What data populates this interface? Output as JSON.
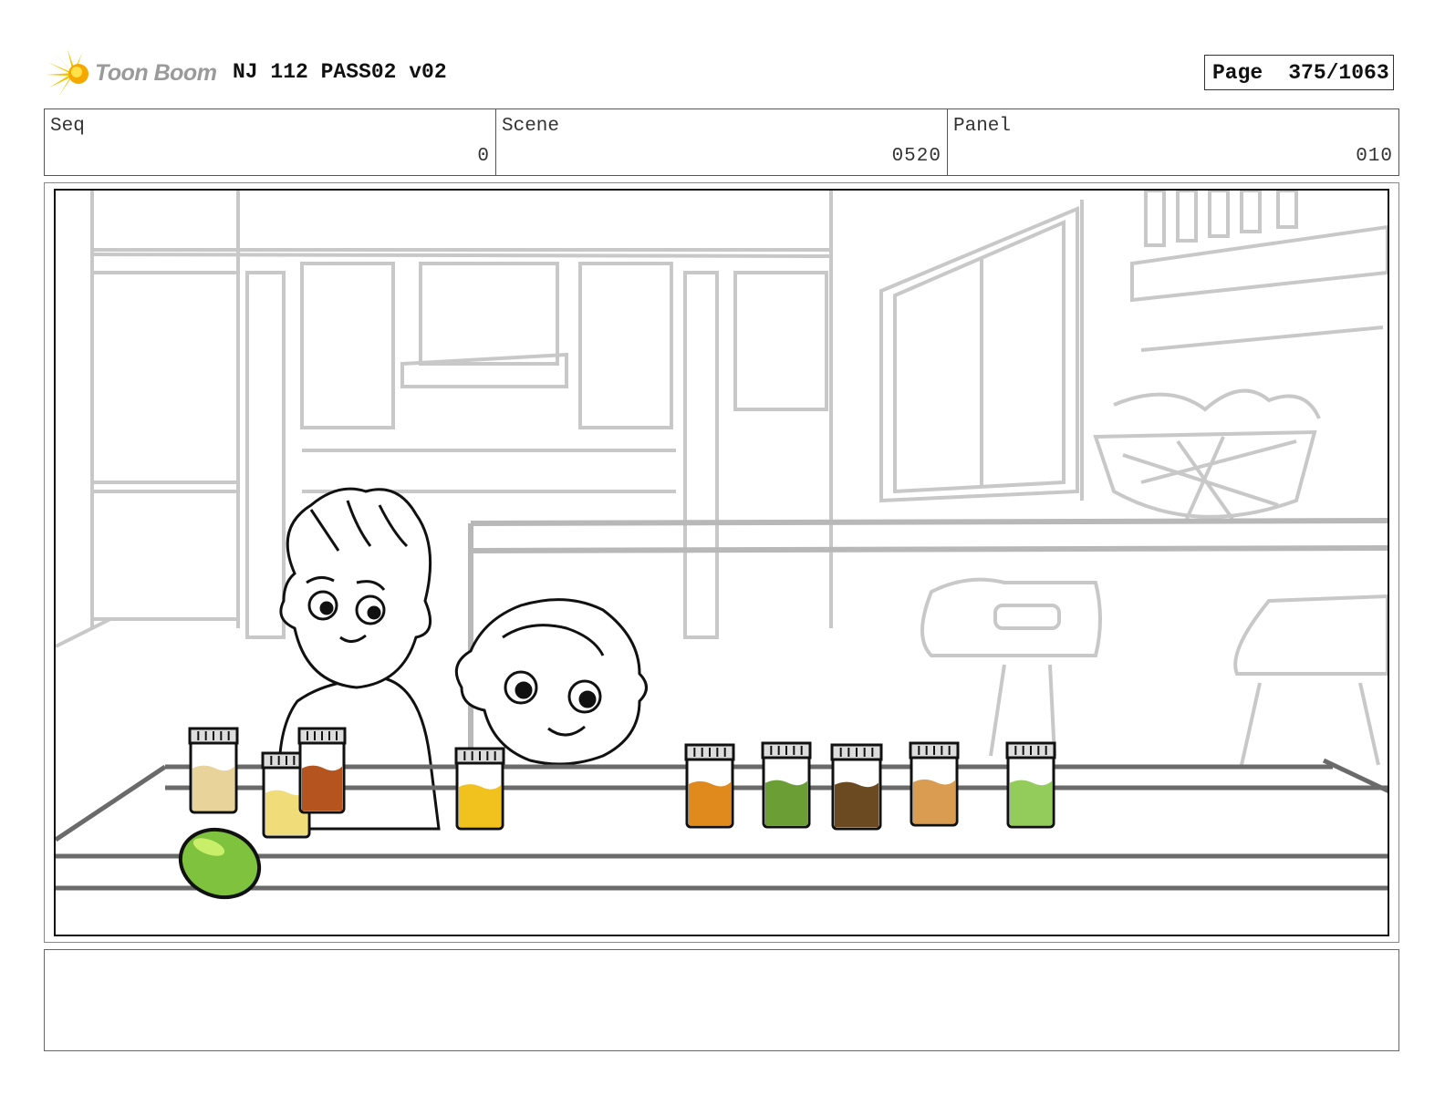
{
  "header": {
    "logo_text": "Toon Boom",
    "project_title": "NJ 112 PASS02 v02",
    "page_label": "Page",
    "page_number": "375/1063"
  },
  "info": {
    "seq_label": "Seq",
    "seq_value": "0",
    "scene_label": "Scene",
    "scene_value": "0520",
    "panel_label": "Panel",
    "panel_value": "010"
  },
  "panel": {
    "jar_colors": [
      "#e8d49a",
      "#f0dc78",
      "#b5541e",
      "#f1c21e",
      "#e08a1e",
      "#6b9e35",
      "#6b4a22",
      "#d99c50",
      "#93cc5a"
    ],
    "lime_color": "#7ec23e"
  },
  "notes": ""
}
